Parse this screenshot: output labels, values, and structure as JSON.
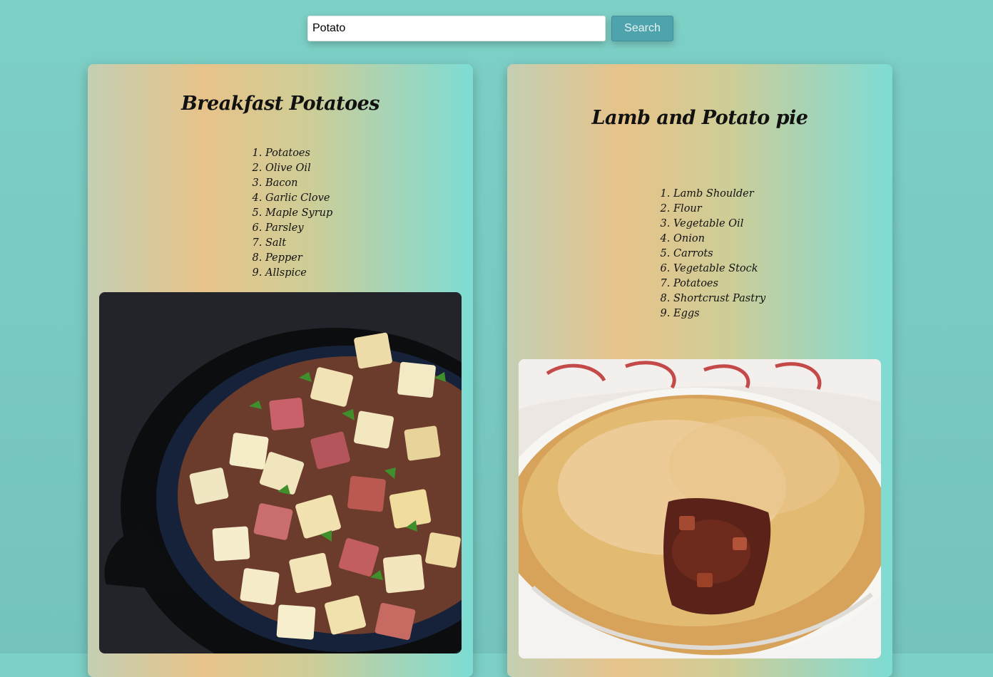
{
  "search": {
    "value": "Potato",
    "button_label": "Search"
  },
  "recipes": [
    {
      "title": "Breakfast Potatoes",
      "ingredients": [
        "Potatoes",
        "Olive Oil",
        "Bacon",
        "Garlic Clove",
        "Maple Syrup",
        "Parsley",
        "Salt",
        "Pepper",
        "Allspice"
      ],
      "image_alt": "skillet of breakfast potatoes"
    },
    {
      "title": "Lamb and Potato pie",
      "ingredients": [
        "Lamb Shoulder",
        "Flour",
        "Vegetable Oil",
        "Onion",
        "Carrots",
        "Vegetable Stock",
        "Potatoes",
        "Shortcrust Pastry",
        "Eggs"
      ],
      "image_alt": "lamb and potato pie"
    }
  ]
}
